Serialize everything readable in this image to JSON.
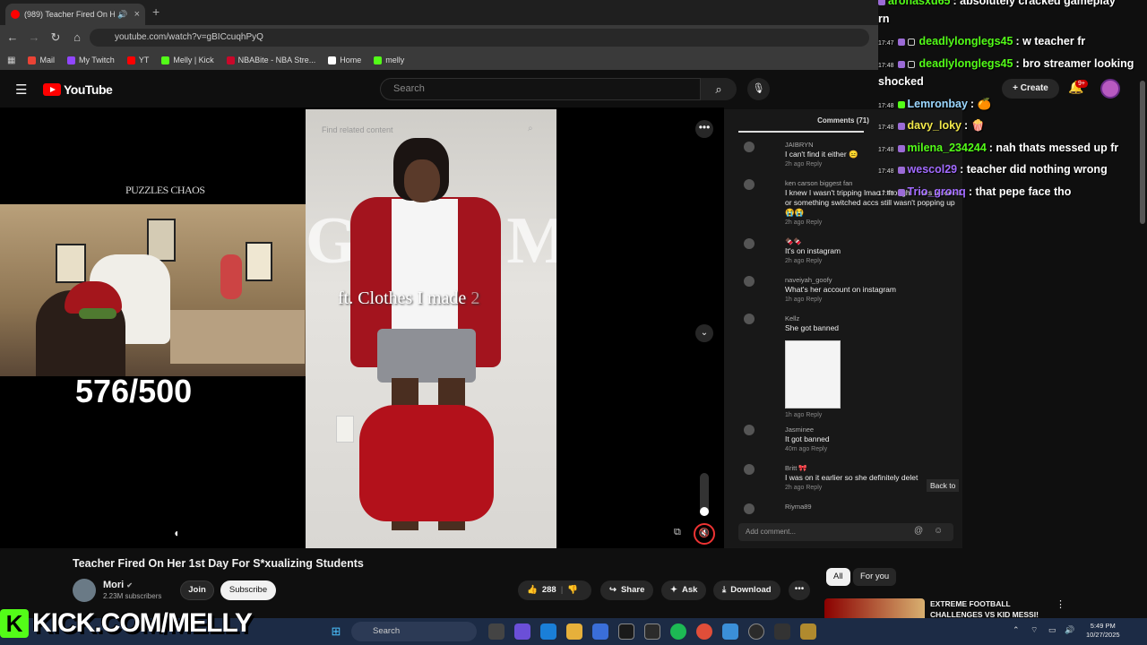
{
  "browser": {
    "tab_title": "(989) Teacher Fired On Her",
    "url": "youtube.com/watch?v=gBICcuqhPyQ",
    "bookmarks": [
      "Mail",
      "My Twitch",
      "YT",
      "Melly | Kick",
      "NBABite - NBA Stre...",
      "Home",
      "melly"
    ],
    "bookmark_colors": [
      "#ea4335",
      "#9146ff",
      "#ff0000",
      "#53fc18",
      "#c9082a",
      "#ffffff",
      "#53fc18"
    ]
  },
  "youtube": {
    "logo": "YouTube",
    "search_placeholder": "Search",
    "create_label": "Create",
    "notif_badge": "9+"
  },
  "video_overlay": {
    "find_related": "Find related content",
    "grwm": "GRWM",
    "ft_text": "ft. Clothes I made",
    "ft_num": "2"
  },
  "comments": {
    "header": "Comments (71)",
    "items": [
      {
        "user": "JAIBRYN",
        "text": "I can't find it either 😑",
        "meta": "2h ago   Reply"
      },
      {
        "user": "ken carson biggest fan",
        "text": "I knew I wasn't tripping lmao I thought I was blocked or something switched accs still wasn't popping up 😭😭",
        "meta": "2h ago   Reply"
      },
      {
        "user": "🍫🍫",
        "text": "It's on instagram",
        "meta": "2h ago   Reply"
      },
      {
        "user": "naveiyah_goofy",
        "text": "What's her account on instagram",
        "meta": "1h ago   Reply"
      },
      {
        "user": "Kellz",
        "text": "She got banned",
        "meta": "1h ago   Reply"
      },
      {
        "user": "Jasminee",
        "text": "It got banned",
        "meta": "40m ago   Reply"
      },
      {
        "user": "Britt 🎀",
        "text": "I was on it earlier so she definitely delet",
        "meta": "2h ago   Reply"
      },
      {
        "user": "Riyma89",
        "text": "",
        "meta": ""
      }
    ],
    "back_to": "Back to",
    "add_placeholder": "Add comment..."
  },
  "stream": {
    "overlay_brand": "PUZZLES CHAOS",
    "counter": "576/500",
    "kick_url": "KICK.COM/MELLY",
    "kick_k": "K"
  },
  "video": {
    "title": "Teacher Fired On Her 1st Day For S*xualizing Students",
    "channel": "Mori",
    "subscribers": "2.23M subscribers",
    "join": "Join",
    "subscribe": "Subscribe",
    "likes": "288",
    "share": "Share",
    "ask": "Ask",
    "download": "Download"
  },
  "sidebar": {
    "chips": [
      "All",
      "For you"
    ],
    "rec_title": "EXTREME FOOTBALL CHALLENGES VS KID MESSI!"
  },
  "chat": [
    {
      "time": "",
      "user": "aronasxd65",
      "color": "#53fc18",
      "msg": ": absolutely cracked gameplay"
    },
    {
      "time": "",
      "user": "",
      "color": "#ffffff",
      "msg": "rn"
    },
    {
      "time": "17:47",
      "user": "deadlylonglegs45",
      "color": "#53fc18",
      "msg": ": w teacher fr"
    },
    {
      "time": "17:48",
      "user": "deadlylonglegs45",
      "color": "#53fc18",
      "msg": ": bro streamer looking"
    },
    {
      "time": "",
      "user": "",
      "color": "#ffffff",
      "msg": "shocked"
    },
    {
      "time": "17:48",
      "user": "Lemronbay",
      "color": "#9bd7ff",
      "msg": ": 🍊"
    },
    {
      "time": "17:48",
      "user": "davy_loky",
      "color": "#f2e84a",
      "msg": ": 🍿"
    },
    {
      "time": "17:48",
      "user": "milena_234244",
      "color": "#53fc18",
      "msg": ": nah thats messed up fr"
    },
    {
      "time": "17:48",
      "user": "wescol29",
      "color": "#a26bff",
      "msg": ": teacher did nothing wrong"
    },
    {
      "time": "17:48",
      "user": "Trio_gronq",
      "color": "#a26bff",
      "msg": ": that pepe face tho"
    }
  ],
  "taskbar": {
    "search": "Search",
    "time": "5:49 PM",
    "date": "10/27/2025"
  }
}
